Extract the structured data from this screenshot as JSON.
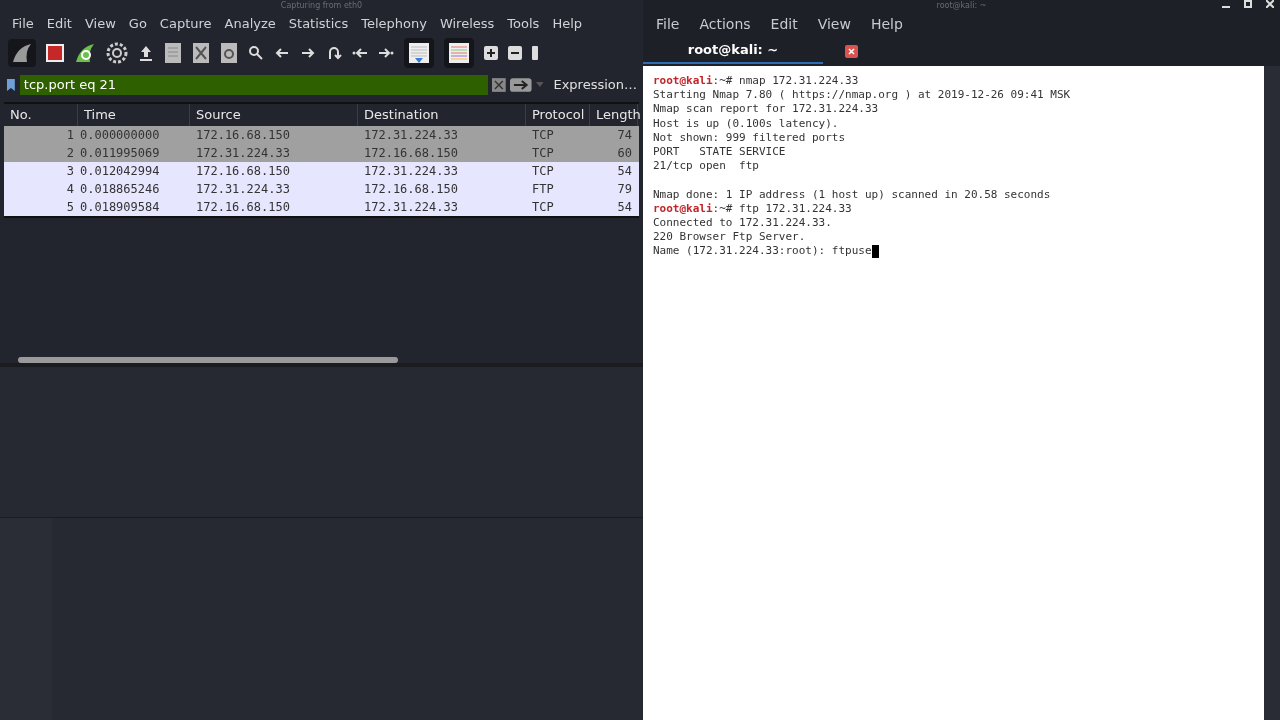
{
  "wireshark": {
    "title": "Capturing from eth0",
    "menu": [
      "File",
      "Edit",
      "View",
      "Go",
      "Capture",
      "Analyze",
      "Statistics",
      "Telephony",
      "Wireless",
      "Tools",
      "Help"
    ],
    "filter": {
      "value": "tcp.port eq 21",
      "valid": true
    },
    "expression_button": "Expression…",
    "columns": [
      "No.",
      "Time",
      "Source",
      "Destination",
      "Protocol",
      "Length"
    ],
    "rows": [
      {
        "cells": [
          "1",
          "0.000000000",
          "172.16.68.150",
          "172.31.224.33",
          "TCP",
          "74"
        ],
        "color": "#a0a0a0"
      },
      {
        "cells": [
          "2",
          "0.011995069",
          "172.31.224.33",
          "172.16.68.150",
          "TCP",
          "60"
        ],
        "color": "#a0a0a0"
      },
      {
        "cells": [
          "3",
          "0.012042994",
          "172.16.68.150",
          "172.31.224.33",
          "TCP",
          "54"
        ],
        "color": "#e7e6ff"
      },
      {
        "cells": [
          "4",
          "0.018865246",
          "172.31.224.33",
          "172.16.68.150",
          "FTP",
          "79"
        ],
        "color": "#e7e6ff"
      },
      {
        "cells": [
          "5",
          "0.018909584",
          "172.16.68.150",
          "172.31.224.33",
          "TCP",
          "54"
        ],
        "color": "#e7e6ff"
      }
    ]
  },
  "terminal": {
    "title": "root@kali: ~",
    "menu": [
      "File",
      "Actions",
      "Edit",
      "View",
      "Help"
    ],
    "tab": {
      "label": "root@kali: ~",
      "selected": true
    },
    "lines": [
      {
        "kind": "prompt",
        "user": "root@kali",
        "path": ":~# ",
        "text": "nmap 172.31.224.33"
      },
      {
        "kind": "output",
        "text": "Starting Nmap 7.80 ( https://nmap.org ) at 2019-12-26 09:41 MSK"
      },
      {
        "kind": "output",
        "text": "Nmap scan report for 172.31.224.33"
      },
      {
        "kind": "output",
        "text": "Host is up (0.100s latency)."
      },
      {
        "kind": "output",
        "text": "Not shown: 999 filtered ports"
      },
      {
        "kind": "output",
        "text": "PORT   STATE SERVICE"
      },
      {
        "kind": "output",
        "text": "21/tcp open  ftp"
      },
      {
        "kind": "blank"
      },
      {
        "kind": "output",
        "text": "Nmap done: 1 IP address (1 host up) scanned in 20.58 seconds"
      },
      {
        "kind": "prompt",
        "user": "root@kali",
        "path": ":~# ",
        "text": "ftp 172.31.224.33"
      },
      {
        "kind": "output",
        "text": "Connected to 172.31.224.33."
      },
      {
        "kind": "output",
        "text": "220 Browser Ftp Server."
      },
      {
        "kind": "input",
        "text": "Name (172.31.224.33:root): ftpuse"
      }
    ]
  }
}
